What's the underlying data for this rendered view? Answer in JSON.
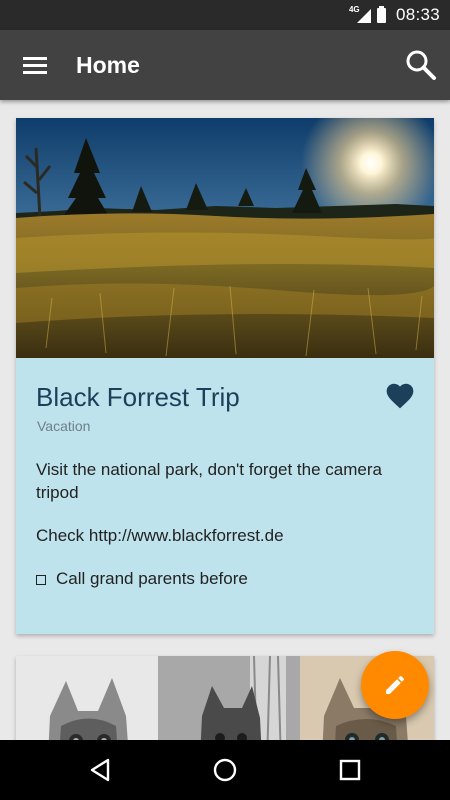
{
  "status_bar": {
    "network": "4G",
    "time": "08:33",
    "icons": [
      "signal-icon",
      "battery-icon"
    ]
  },
  "app_bar": {
    "title": "Home",
    "icons": [
      "menu-icon",
      "search-icon"
    ]
  },
  "note_card": {
    "title": "Black Forrest Trip",
    "label": "Vacation",
    "body_line_1": "Visit the national park, don't forget the camera tripod",
    "body_line_2": "Check http://www.blackforrest.de",
    "checklist_item": "Call grand parents before",
    "favorite_icon": "heart-icon",
    "background_color": "#bee3ec",
    "title_color": "#1c3f5a"
  },
  "fab": {
    "icon": "pencil-icon",
    "color": "#ff8a00"
  },
  "nav_bar": {
    "icons": [
      "back-icon",
      "home-icon",
      "recents-icon"
    ]
  }
}
